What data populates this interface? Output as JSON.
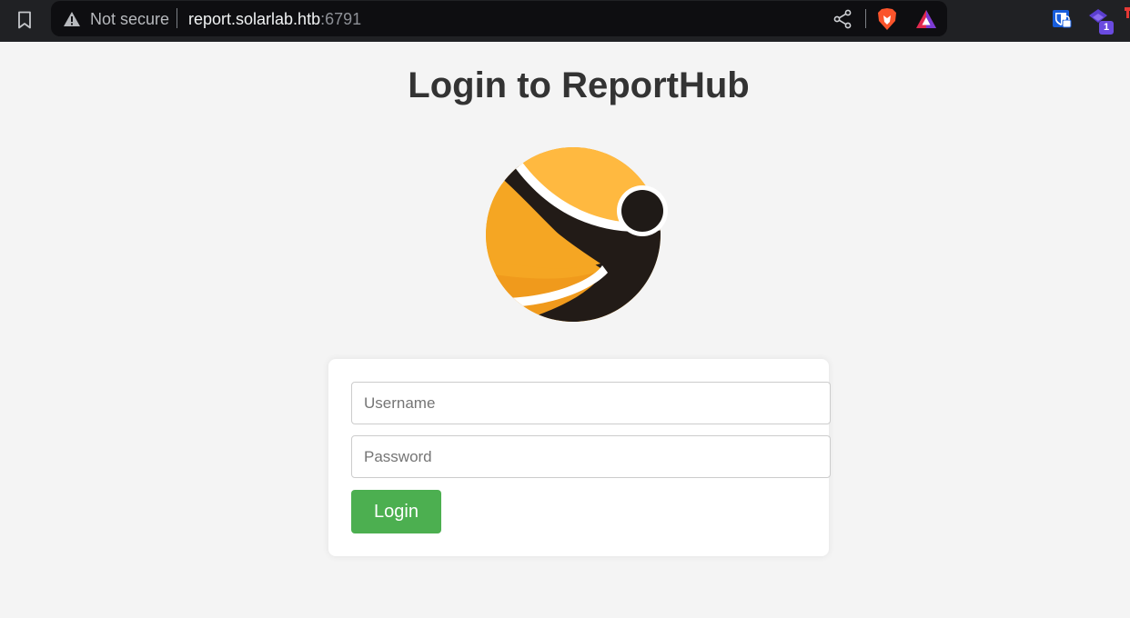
{
  "browser": {
    "security_label": "Not secure",
    "url_host": "report.solarlab.htb",
    "url_port": ":6791",
    "extension_badge_count": "1",
    "icons": {
      "bookmark": "bookmark-icon",
      "warning": "warning-triangle-icon",
      "share": "share-icon",
      "shield": "brave-shield-icon",
      "rewards": "brave-rewards-icon",
      "password_manager": "bitwarden-icon",
      "extension": "extension-icon"
    }
  },
  "page": {
    "title": "Login to ReportHub",
    "logo": "reporthub-logo"
  },
  "login_form": {
    "username_placeholder": "Username",
    "password_placeholder": "Password",
    "submit_label": "Login"
  },
  "colors": {
    "page_background": "#f4f4f4",
    "title": "#333333",
    "login_button": "#4caf50",
    "logo_orange": "#f5a623",
    "logo_dark": "#1f1a17",
    "chrome_background": "#202124"
  }
}
